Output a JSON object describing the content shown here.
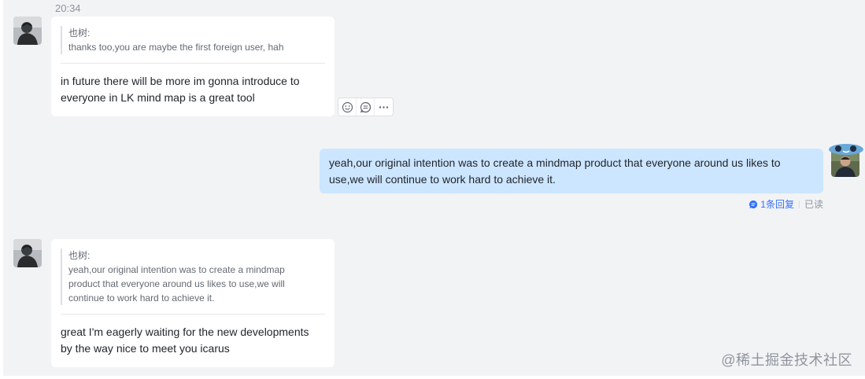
{
  "timestamp": "20:34",
  "messages": [
    {
      "quote_author": "也树:",
      "quote_text": "thanks too,you are maybe the first foreign user, hah",
      "text_lines": [
        "in future there will be more im gonna introduce to",
        "everyone in LK mind map is a great tool"
      ]
    },
    {
      "self": true,
      "text_lines": [
        "yeah,our original intention was to create a mindmap product that everyone around us likes to",
        "use,we will continue to work hard to achieve it."
      ],
      "reply_label": "1条回复",
      "read_label": "已读"
    },
    {
      "quote_author": "也树:",
      "quote_lines": [
        "yeah,our original intention was to create a mindmap",
        "product that everyone around us likes to use,we will",
        "continue to work hard to achieve it."
      ],
      "text_lines": [
        "great I'm eagerly waiting for the new developments",
        "by the way nice to meet you icarus"
      ]
    }
  ],
  "message_actions": [
    "emoji-reaction-icon",
    "reply-in-thread-icon",
    "more-icon"
  ],
  "watermark": "@稀土掘金技术社区",
  "colors": {
    "background": "#f2f3f5",
    "self_bubble": "#cce6ff",
    "link": "#3370ff"
  }
}
